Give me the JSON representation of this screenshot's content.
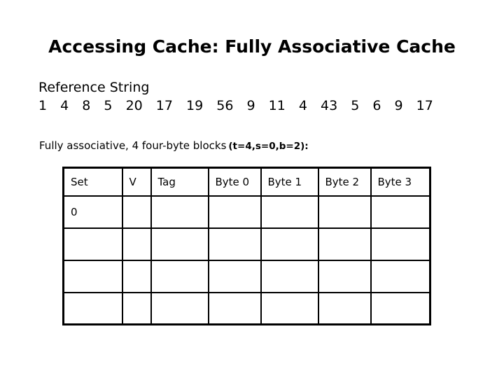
{
  "slide": {
    "title": "Accessing Cache: Fully Associative Cache",
    "background_color": "#ffffff",
    "text_color": "#000000"
  },
  "reference_string": {
    "label": "Reference String",
    "values": [
      "1",
      "4",
      "8",
      "5",
      "20",
      "17",
      "19",
      "56",
      "9",
      "11",
      "4",
      "43",
      "5",
      "6",
      "9",
      "17"
    ]
  },
  "cache_config": {
    "description": "Fully associative, 4 four-byte blocks",
    "parameters": "(t=4,s=0,b=2):"
  },
  "cache_table": {
    "headers": [
      "Set",
      "V",
      "Tag",
      "Byte 0",
      "Byte 1",
      "Byte 2",
      "Byte 3"
    ],
    "rows": [
      {
        "set": "0",
        "v": "",
        "tag": "",
        "byte0": "",
        "byte1": "",
        "byte2": "",
        "byte3": ""
      },
      {
        "set": "",
        "v": "",
        "tag": "",
        "byte0": "",
        "byte1": "",
        "byte2": "",
        "byte3": ""
      },
      {
        "set": "",
        "v": "",
        "tag": "",
        "byte0": "",
        "byte1": "",
        "byte2": "",
        "byte3": ""
      },
      {
        "set": "",
        "v": "",
        "tag": "",
        "byte0": "",
        "byte1": "",
        "byte2": "",
        "byte3": ""
      }
    ]
  }
}
